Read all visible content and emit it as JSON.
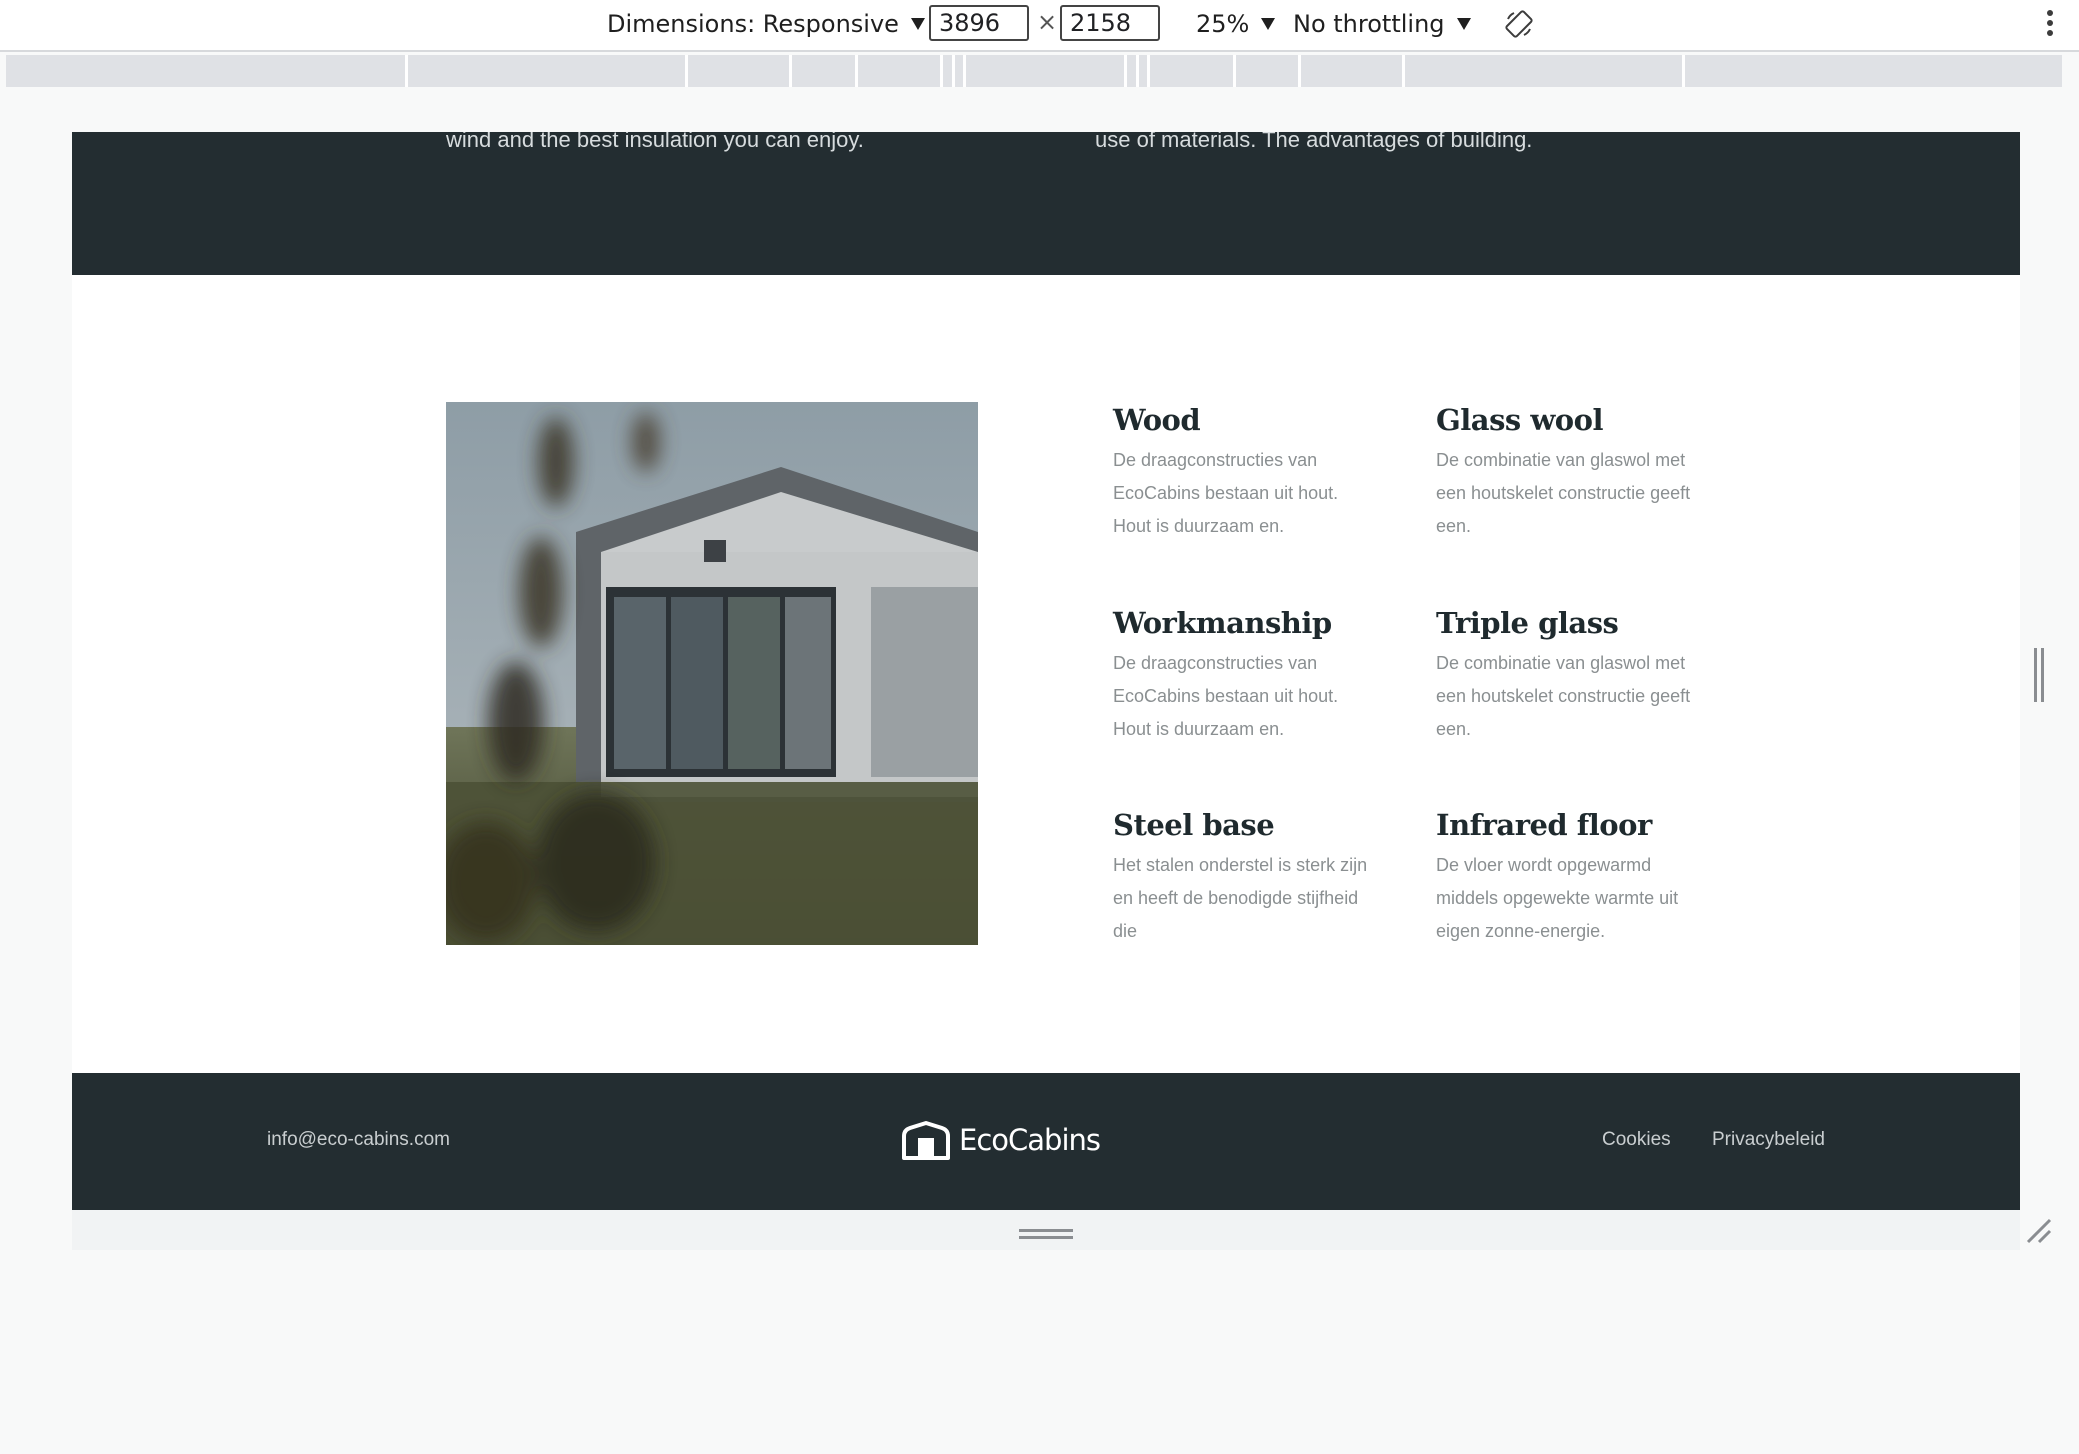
{
  "devtools": {
    "dimensions_label": "Dimensions: Responsive",
    "width_value": "3896",
    "height_value": "2158",
    "times": "×",
    "zoom": "25%",
    "throttling": "No throttling"
  },
  "intro": {
    "left_text": "wind and the best insulation you can enjoy.",
    "right_text": "use of materials. The advantages of building."
  },
  "features": [
    {
      "title": "Wood",
      "text": "De draagconstructies van EcoCabins bestaan uit hout. Hout is duurzaam en."
    },
    {
      "title": "Glass wool",
      "text": "De combinatie van glaswol met een houtskelet constructie geeft een."
    },
    {
      "title": "Workmanship",
      "text": "De draagconstructies van EcoCabins bestaan uit hout. Hout is duurzaam en."
    },
    {
      "title": "Triple glass",
      "text": "De combinatie van glaswol met een houtskelet constructie geeft een."
    },
    {
      "title": "Steel base",
      "text": "Het stalen onderstel is sterk zijn en heeft de benodigde stijfheid die"
    },
    {
      "title": "Infrared floor",
      "text": "De vloer wordt opgewarmd middels opgewekte warmte uit eigen zonne-energie."
    }
  ],
  "footer": {
    "email": "info@eco-cabins.com",
    "logo": "EcoCabins",
    "links": [
      "Cookies",
      "Privacybeleid"
    ]
  },
  "colors": {
    "dark": "#232d31",
    "heading": "#1f2a2e",
    "body_text": "#8a8f91"
  }
}
